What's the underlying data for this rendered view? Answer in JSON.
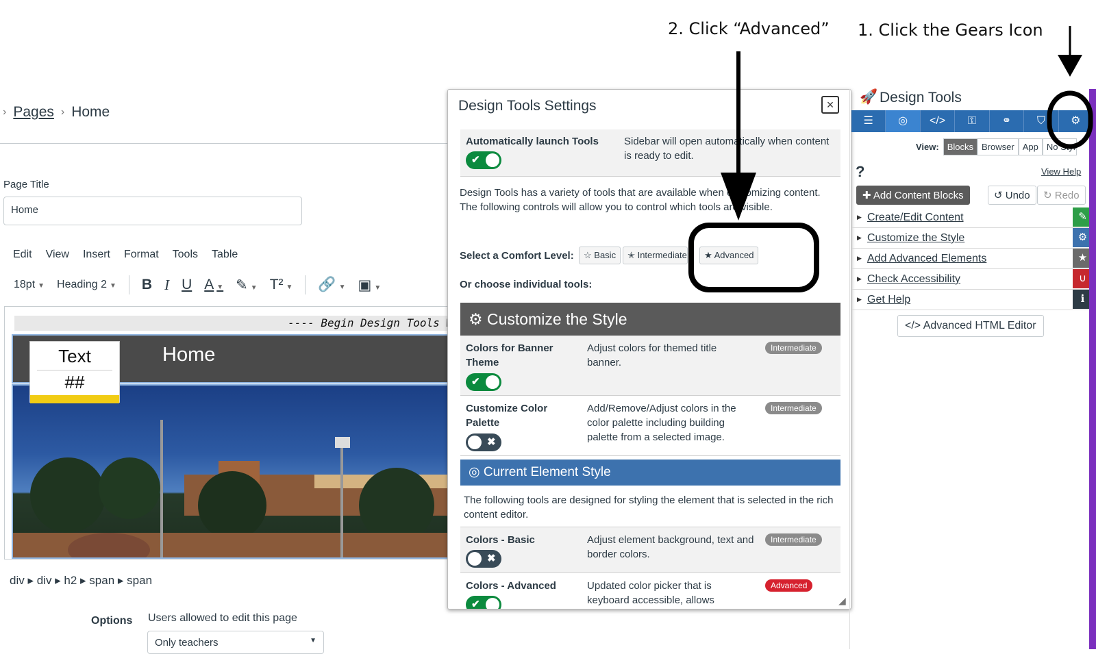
{
  "annotations": {
    "step1": "1. Click the Gears Icon",
    "step2": "2. Click “Advanced”"
  },
  "breadcrumb": {
    "pages": "Pages",
    "home": "Home"
  },
  "page_title": {
    "label": "Page Title",
    "value": "Home"
  },
  "menubar": [
    "Edit",
    "View",
    "Insert",
    "Format",
    "Tools",
    "Table"
  ],
  "toolbar": {
    "font_size": "18pt",
    "block": "Heading 2",
    "bold": "B",
    "italic": "I",
    "underline": "U",
    "color": "A",
    "superscript": "T²"
  },
  "editor": {
    "begin_marker": "---- Begin Design Tools W",
    "banner_title": "Home",
    "textbox_line1": "Text",
    "textbox_line2": "##"
  },
  "element_path": "div ▸ div ▸ h2 ▸ span ▸ span",
  "options": {
    "label": "Options",
    "text": "Users allowed to edit this page",
    "select_value": "Only teachers"
  },
  "modal": {
    "title": "Design Tools Settings",
    "close": "×",
    "auto_launch": {
      "label": "Automatically launch Tools",
      "desc": "Sidebar will open automatically when content is ready to edit."
    },
    "intro": "Design Tools has a variety of tools that are available when customizing content. The following controls will allow you to control which tools are visible.",
    "comfort": {
      "label": "Select a Comfort Level:",
      "basic": "Basic",
      "intermediate": "Intermediate",
      "advanced": "Advanced"
    },
    "individual": "Or choose individual tools:",
    "section_style": "Customize the Style",
    "features": [
      {
        "name": "Colors for Banner Theme",
        "desc": "Adjust colors for themed title banner.",
        "level": "Intermediate"
      },
      {
        "name": "Customize Color Palette",
        "desc": "Add/Remove/Adjust colors in the color palette including building palette from a selected image.",
        "level": "Intermediate"
      }
    ],
    "section_element": "Current Element Style",
    "element_intro": "The following tools are designed for styling the element that is selected in the rich content editor.",
    "element_features": [
      {
        "name": "Colors - Basic",
        "desc": "Adjust element background, text and border colors.",
        "level": "Intermediate"
      },
      {
        "name": "Colors - Advanced",
        "desc": "Updated color picker that is keyboard accessible, allows",
        "level": "Advanced"
      }
    ]
  },
  "sidebar": {
    "title": "Design Tools",
    "view_label": "View:",
    "views": [
      "Blocks",
      "Browser",
      "App",
      "No Style"
    ],
    "help_q": "?",
    "view_help": "View Help",
    "add_blocks": "Add Content Blocks",
    "undo": "Undo",
    "redo": "Redo",
    "items": [
      {
        "label": "Create/Edit Content",
        "color": "#2e9e48"
      },
      {
        "label": "Customize the Style",
        "color": "#3d72ae"
      },
      {
        "label": "Add Advanced Elements",
        "color": "#6b6b6b"
      },
      {
        "label": "Check Accessibility",
        "color": "#c6282e"
      },
      {
        "label": "Get Help",
        "color": "#2d3b45"
      }
    ],
    "html_editor": "Advanced HTML Editor"
  }
}
